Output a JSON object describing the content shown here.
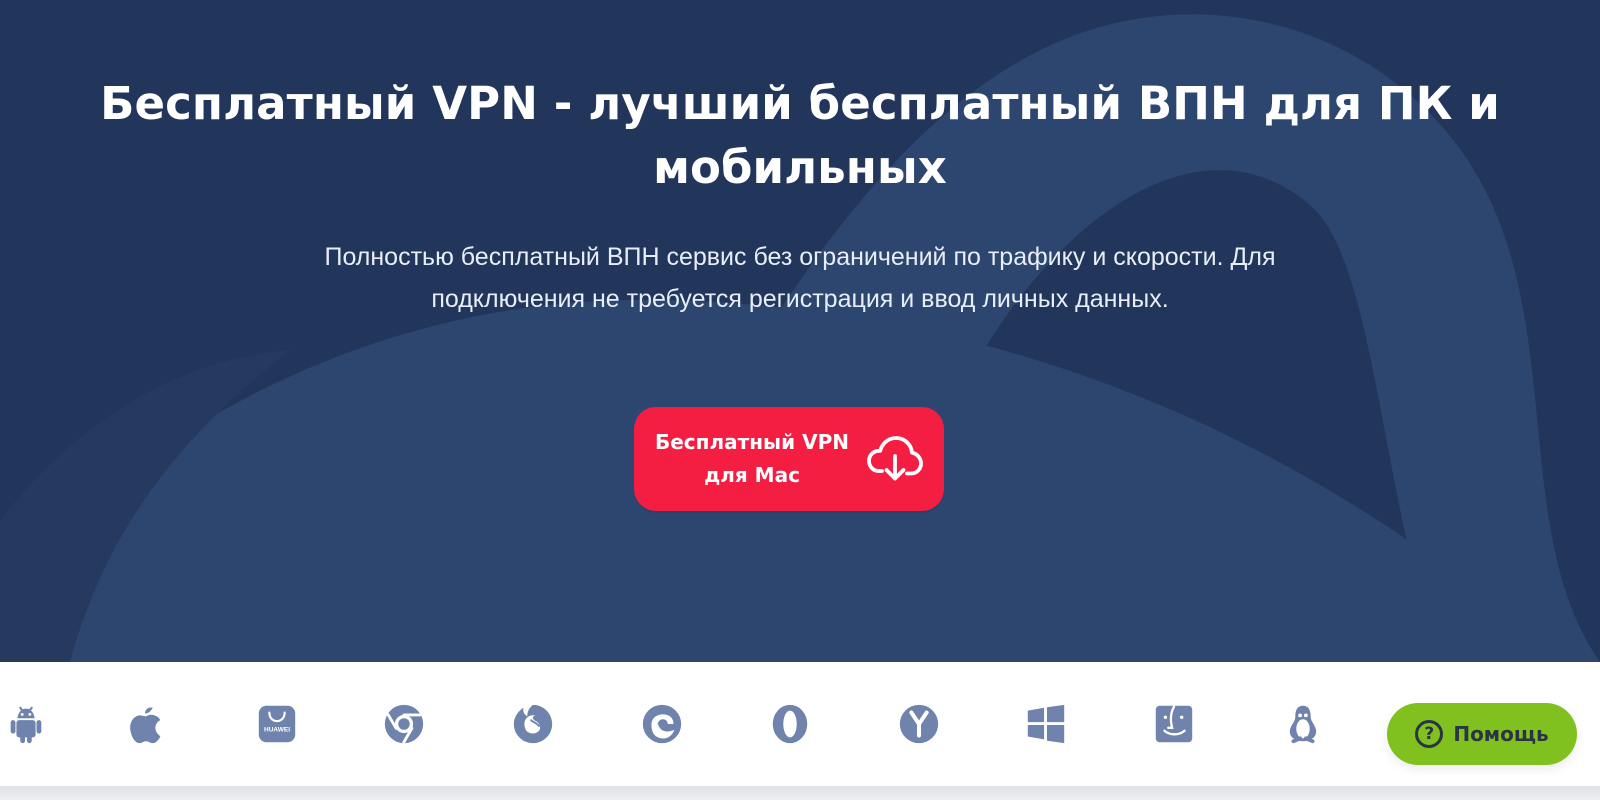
{
  "hero": {
    "title_line_1": "Бесплатный VPN - лучший бесплатный ВПН для ПК и",
    "title_line_2": "мобильных",
    "description_line_1": "Полностью бесплатный ВПН сервис без ограничений по трафику и скорости. Для",
    "description_line_2": "подключения не требуется регистрация и ввод личных данных.",
    "background_color": "#22355a",
    "shape_color": "#2d466f"
  },
  "download_button": {
    "label_line_1": "Бесплатный VPN",
    "label_line_2": "для Mac",
    "icon": "cloud-download-icon",
    "color": "#f41e43"
  },
  "platforms": [
    {
      "name": "android",
      "icon": "android-icon"
    },
    {
      "name": "apple",
      "icon": "apple-icon"
    },
    {
      "name": "huawei",
      "icon": "huawei-appgallery-icon",
      "label": "HUAWEI"
    },
    {
      "name": "chrome",
      "icon": "chrome-icon"
    },
    {
      "name": "firefox",
      "icon": "firefox-icon"
    },
    {
      "name": "edge",
      "icon": "edge-icon"
    },
    {
      "name": "opera",
      "icon": "opera-icon"
    },
    {
      "name": "yandex",
      "icon": "yandex-browser-icon"
    },
    {
      "name": "windows",
      "icon": "windows-icon"
    },
    {
      "name": "finder",
      "icon": "finder-icon"
    },
    {
      "name": "linux",
      "icon": "linux-icon"
    }
  ],
  "platform_icon_color": "#6f83ad",
  "help_button": {
    "icon_symbol": "?",
    "label": "Помощь",
    "icon": "help-icon",
    "color": "#80c11f"
  }
}
